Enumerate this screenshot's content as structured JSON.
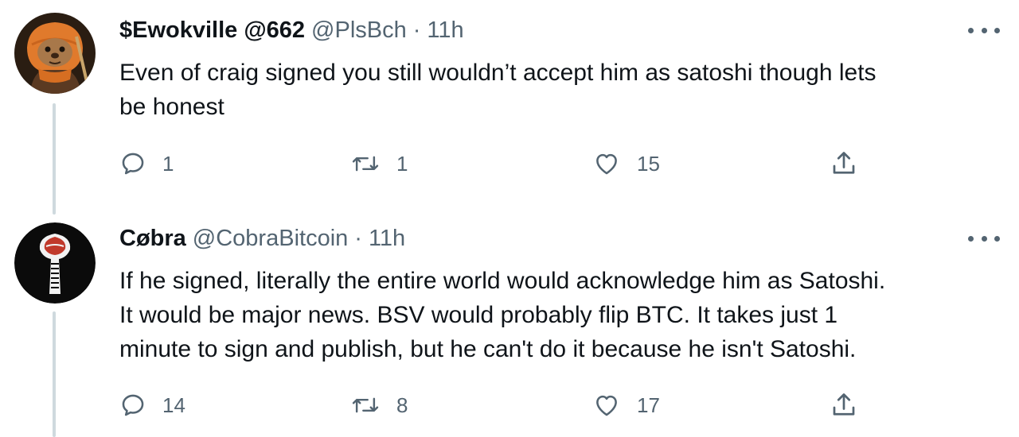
{
  "tweets": [
    {
      "name": "$Ewokville @662",
      "handle": "@PlsBch",
      "separator": "·",
      "time": "11h",
      "text_lines": [
        "Even of craig signed you still wouldn’t accept him as satoshi though lets",
        "be honest"
      ],
      "avatar": "ewok-avatar",
      "more_icon": "more-options-icon",
      "actions": {
        "reply": {
          "icon": "reply-icon",
          "count": "1"
        },
        "retweet": {
          "icon": "retweet-icon",
          "count": "1"
        },
        "like": {
          "icon": "like-icon",
          "count": "15"
        },
        "share": {
          "icon": "share-icon"
        }
      }
    },
    {
      "name": "Cøbra",
      "handle": "@CobraBitcoin",
      "separator": "·",
      "time": "11h",
      "text_lines": [
        "If he signed, literally the entire world would acknowledge him as Satoshi.",
        "It would be major news. BSV would probably flip BTC. It takes just 1",
        "minute to sign and publish, but he can't do it because he isn't Satoshi."
      ],
      "avatar": "cobra-avatar",
      "more_icon": "more-options-icon",
      "actions": {
        "reply": {
          "icon": "reply-icon",
          "count": "14"
        },
        "retweet": {
          "icon": "retweet-icon",
          "count": "8"
        },
        "like": {
          "icon": "like-icon",
          "count": "17"
        },
        "share": {
          "icon": "share-icon"
        }
      }
    }
  ],
  "colors": {
    "text_primary": "#0f1419",
    "text_secondary": "#536471",
    "thread_line": "#cfd9de",
    "background": "#ffffff"
  }
}
